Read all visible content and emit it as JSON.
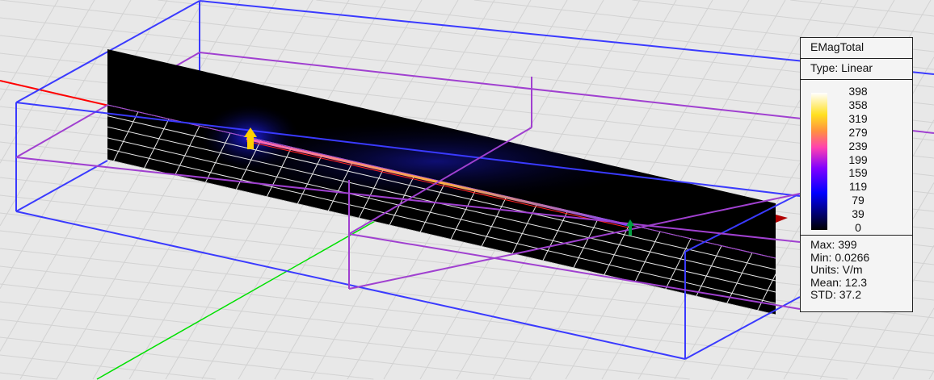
{
  "legend": {
    "title": "EMagTotal",
    "type": "Type: Linear",
    "ticks": [
      "398",
      "358",
      "319",
      "279",
      "239",
      "199",
      "159",
      "119",
      "79",
      "39",
      "0"
    ],
    "stats": {
      "max": "Max: 399",
      "min": "Min: 0.0266",
      "units": "Units: V/m",
      "mean": "Mean: 12.3",
      "std": "STD: 37.2"
    }
  },
  "colors": {
    "background": "#e8e8e8",
    "outer_box": "#3a3aff",
    "inner_box": "#a040d0",
    "x_axis": "#ff0000",
    "y_axis": "#00e000",
    "source_arrow": "#ffd000",
    "load_arrow": "#00a040"
  }
}
